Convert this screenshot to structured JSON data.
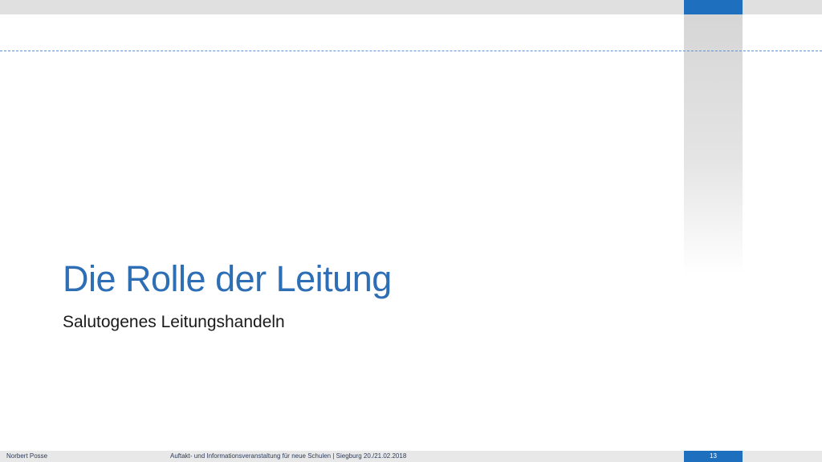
{
  "slide": {
    "title": "Die Rolle der Leitung",
    "subtitle": "Salutogenes Leitungshandeln"
  },
  "footer": {
    "author": "Norbert Posse",
    "event": "Auftakt- und Informationsveranstaltung für neue Schulen | Siegburg 20./21.02.2018",
    "page_number": "13"
  },
  "colors": {
    "accent_blue": "#1f6fbf",
    "title_blue": "#2e6eb5",
    "bar_gray": "#e0e0e0"
  }
}
